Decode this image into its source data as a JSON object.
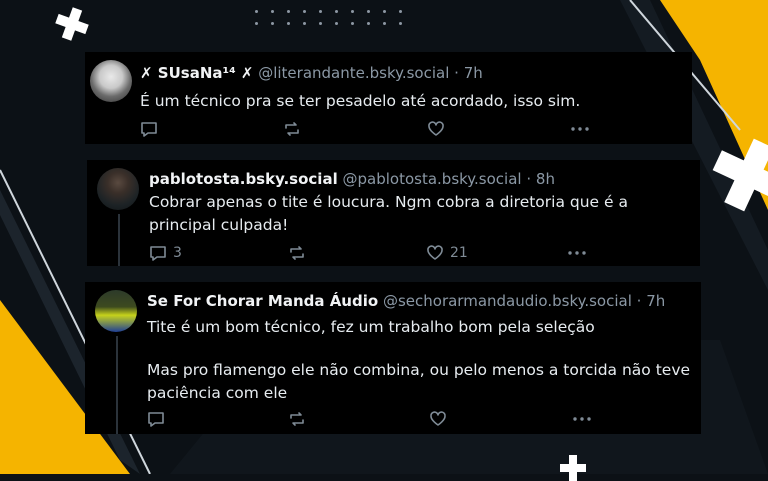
{
  "posts": [
    {
      "display_name": "✗ SUsaNa¹⁴ ✗",
      "handle": "@literandante.bsky.social",
      "time": "7h",
      "text": "É um técnico pra se ter pesadelo até acordado, isso sim.",
      "reply_count": "",
      "repost_count": "",
      "like_count": ""
    },
    {
      "display_name": "pablotosta.bsky.social",
      "handle": "@pablotosta.bsky.social",
      "time": "8h",
      "text": "Cobrar apenas o tite é loucura. Ngm cobra a diretoria que é a principal culpada!",
      "reply_count": "3",
      "repost_count": "",
      "like_count": "21"
    },
    {
      "display_name": "Se For Chorar Manda Áudio",
      "handle": "@sechorarmandaudio.bsky.social",
      "time": "7h",
      "text_line1": "Tite é um bom técnico, fez um trabalho bom pela seleção",
      "text_line2": "Mas pro flamengo ele não combina, ou pelo menos a torcida não teve paciência com ele"
    }
  ],
  "separator": "·",
  "colors": {
    "accent": "#f5b400",
    "card": "#000000",
    "muted": "#8b98a5"
  },
  "icons": [
    "reply-icon",
    "repost-icon",
    "like-icon",
    "more-icon",
    "plus-icon"
  ]
}
